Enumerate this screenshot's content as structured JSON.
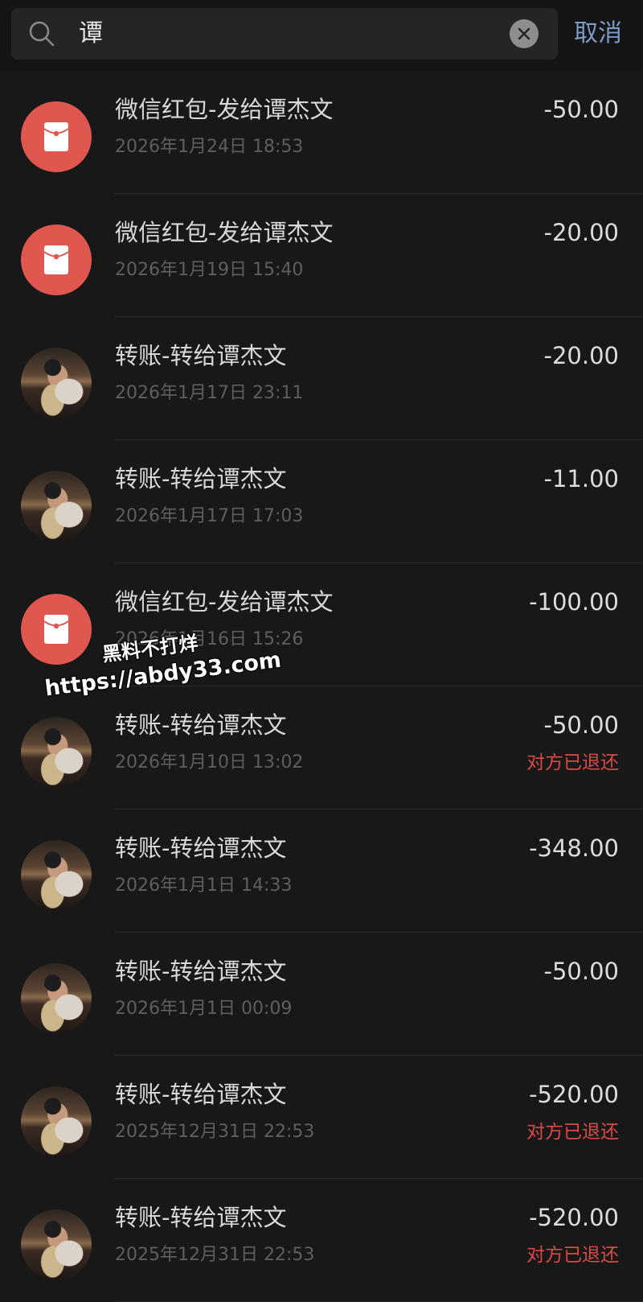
{
  "search": {
    "query": "谭",
    "cancel_label": "取消"
  },
  "transactions": [
    {
      "type": "redpacket",
      "title": "微信红包-发给谭杰文",
      "time": "2026年1月24日 18:53",
      "amount": "-50.00",
      "status": ""
    },
    {
      "type": "redpacket",
      "title": "微信红包-发给谭杰文",
      "time": "2026年1月19日 15:40",
      "amount": "-20.00",
      "status": ""
    },
    {
      "type": "transfer",
      "title": "转账-转给谭杰文",
      "time": "2026年1月17日 23:11",
      "amount": "-20.00",
      "status": ""
    },
    {
      "type": "transfer",
      "title": "转账-转给谭杰文",
      "time": "2026年1月17日 17:03",
      "amount": "-11.00",
      "status": ""
    },
    {
      "type": "redpacket",
      "title": "微信红包-发给谭杰文",
      "time": "2026年1月16日 15:26",
      "amount": "-100.00",
      "status": ""
    },
    {
      "type": "transfer",
      "title": "转账-转给谭杰文",
      "time": "2026年1月10日 13:02",
      "amount": "-50.00",
      "status": "对方已退还"
    },
    {
      "type": "transfer",
      "title": "转账-转给谭杰文",
      "time": "2026年1月1日 14:33",
      "amount": "-348.00",
      "status": ""
    },
    {
      "type": "transfer",
      "title": "转账-转给谭杰文",
      "time": "2026年1月1日 00:09",
      "amount": "-50.00",
      "status": ""
    },
    {
      "type": "transfer",
      "title": "转账-转给谭杰文",
      "time": "2025年12月31日 22:53",
      "amount": "-520.00",
      "status": "对方已退还"
    },
    {
      "type": "transfer",
      "title": "转账-转给谭杰文",
      "time": "2025年12月31日 22:53",
      "amount": "-520.00",
      "status": "对方已退还"
    }
  ],
  "watermark": {
    "line1": "黑料不打烊",
    "line2": "https://abdy33.com"
  },
  "colors": {
    "background": "#181818",
    "accent_link": "#7d9ac7",
    "redpacket": "#e0574f",
    "refund_status": "#d94a44"
  }
}
